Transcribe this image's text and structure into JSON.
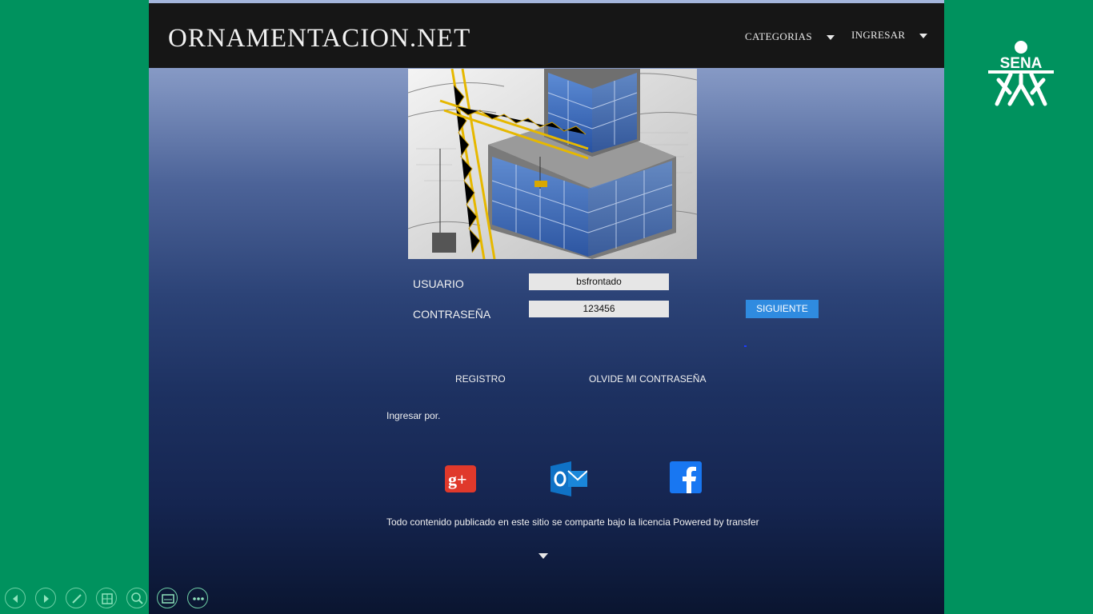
{
  "header": {
    "site_title": "ORNAMENTACION.NET",
    "nav": [
      {
        "label": "CATEGORIAS"
      },
      {
        "label": "INGRESAR"
      }
    ]
  },
  "login": {
    "username_label": "USUARIO",
    "username_value": "bsfrontado",
    "password_label": "CONTRASEÑA",
    "password_value": "123456",
    "submit_label": "SIGUIENTE"
  },
  "links": {
    "register": "REGISTRO",
    "forgot_password": "OLVIDE MI CONTRASEÑA"
  },
  "social": {
    "prompt": "Ingresar por.",
    "providers": [
      {
        "icon": "google-plus-icon",
        "color": "#e0392b"
      },
      {
        "icon": "outlook-icon",
        "color": "#0f72c6"
      },
      {
        "icon": "facebook-icon",
        "color": "#1877f2"
      }
    ]
  },
  "footer": {
    "license_text": "Todo contenido publicado en este sitio se comparte bajo la licencia Powered by transfer"
  },
  "brand": {
    "logo_text": "SENA",
    "background_color": "#00925e"
  },
  "presentation_toolbar": {
    "buttons": [
      "previous-icon",
      "next-icon",
      "pen-icon",
      "slides-icon",
      "zoom-icon",
      "subtitles-icon",
      "more-icon"
    ]
  }
}
